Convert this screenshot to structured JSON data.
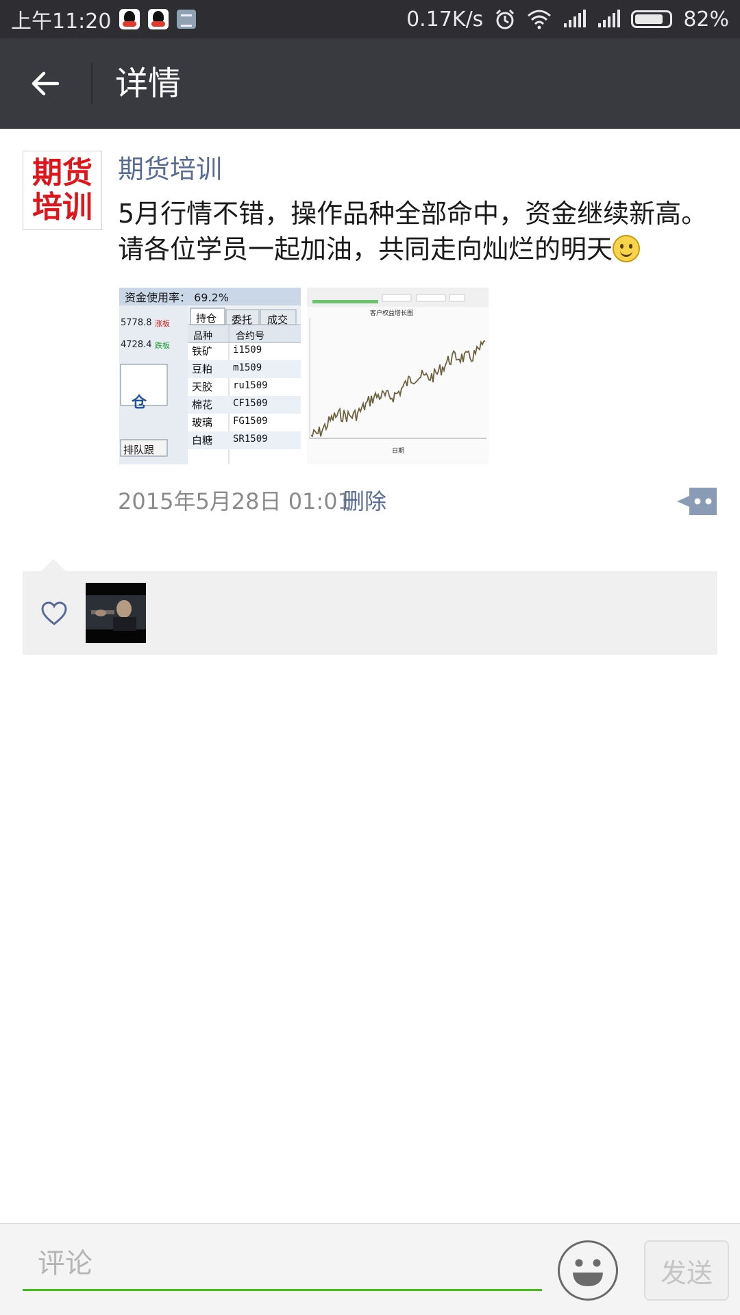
{
  "status_bar": {
    "time": "上午11:20",
    "network_speed": "0.17K/s",
    "battery_percent": "82%",
    "battery_level": 0.82,
    "notification_icons": [
      "qq-icon",
      "qq-icon",
      "document-icon"
    ],
    "status_icons": [
      "alarm-icon",
      "wifi-icon",
      "signal-icon",
      "signal-icon",
      "battery-icon"
    ]
  },
  "header": {
    "title": "详情",
    "back_icon": "arrow-left-icon"
  },
  "post": {
    "avatar_text_line1": "期货",
    "avatar_text_line2": "培训",
    "author": "期货培训",
    "text_line1": "5月行情不错，操作品种全部命中，资金继续新高。",
    "text_line2": "请各位学员一起加油，共同走向灿烂的明天",
    "emoji": "smiley-icon",
    "photos": {
      "photo1": {
        "header": "资金使用率： 69.2%",
        "left_values": [
          "5778.8",
          "4728.4"
        ],
        "left_badges": [
          "涨板",
          "跌板"
        ],
        "tabs": [
          "持仓",
          "委托",
          "成交"
        ],
        "columns": [
          "品种",
          "合约号"
        ],
        "rows": [
          [
            "铁矿",
            "i1509"
          ],
          [
            "豆粕",
            "m1509"
          ],
          [
            "天胶",
            "ru1509"
          ],
          [
            "棉花",
            "CF1509"
          ],
          [
            "玻璃",
            "FG1509"
          ],
          [
            "白糖",
            "SR1509"
          ]
        ],
        "side_button": "仓",
        "queue_button": "排队跟"
      },
      "photo2": {
        "chart_title": "客户权益增长图",
        "x_caption": "日期"
      }
    },
    "time": "2015年5月28日 01:01",
    "delete_label": "删除",
    "more_icon": "comment-more-icon"
  },
  "likes": {
    "icon": "heart-icon",
    "avatars": [
      "liker-avatar"
    ]
  },
  "comment_bar": {
    "placeholder": "评论",
    "emoji_icon": "emoji-face-icon",
    "send_label": "发送"
  },
  "colors": {
    "title_bar": "#393a3f",
    "status_bar": "#2e2e32",
    "link_blue": "#576b95",
    "input_underline": "#45c01a",
    "avatar_red": "#e0151b"
  }
}
